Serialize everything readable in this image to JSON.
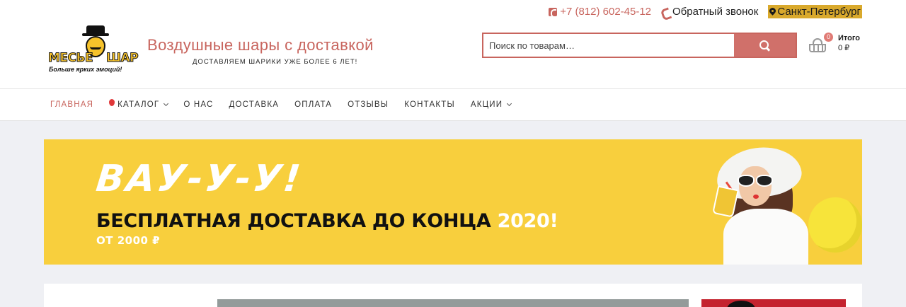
{
  "topbar": {
    "phone": "+7 (812) 602-45-12",
    "callback": "Обратный звонок",
    "city": "Санкт-Петербург"
  },
  "logo": {
    "word1": "МЕСЬЕ",
    "word2": "ШАР",
    "tagline": "Больше ярких эмоций!"
  },
  "site": {
    "title": "Воздушные шары с доставкой",
    "subtitle": "ДОСТАВЛЯЕМ ШАРИКИ УЖЕ БОЛЕЕ 6 ЛЕТ!"
  },
  "search": {
    "placeholder": "Поиск по товарам…"
  },
  "cart": {
    "count": "0",
    "label": "Итого",
    "total": "0 ₽"
  },
  "nav": {
    "items": [
      {
        "label": "ГЛАВНАЯ"
      },
      {
        "label": "КАТАЛОГ"
      },
      {
        "label": "О НАС"
      },
      {
        "label": "ДОСТАВКА"
      },
      {
        "label": "ОПЛАТА"
      },
      {
        "label": "ОТЗЫВЫ"
      },
      {
        "label": "КОНТАКТЫ"
      },
      {
        "label": "АКЦИИ"
      }
    ]
  },
  "banner": {
    "headline": "ВАУ-У-У!",
    "promo": "БЕСПЛАТНАЯ ДОСТАВКА ДО КОНЦА ",
    "year": "2020!",
    "min_order": "ОТ 2000 ₽"
  },
  "colors": {
    "accent": "#c8655e",
    "banner_bg": "#f8cf3d",
    "city_highlight": "#d9a92c"
  }
}
